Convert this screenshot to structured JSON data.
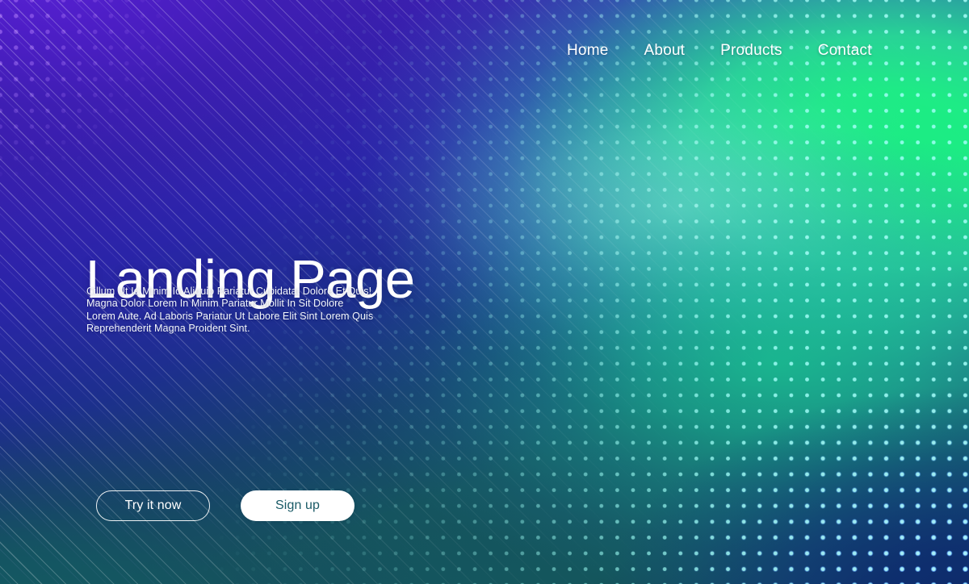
{
  "nav": {
    "items": [
      {
        "label": "Home"
      },
      {
        "label": "About"
      },
      {
        "label": "Products"
      },
      {
        "label": "Contact"
      }
    ]
  },
  "hero": {
    "headline": "Landing Page",
    "paragraphs": [
      "Cillum Ut Id Minim Id Aliquip Pariatur Cupidatat Dolore Et Duis!",
      "Magna Dolor Lorem In Minim Pariatur Mollit In Sit Dolore",
      "Lorem Aute. Ad Laboris Pariatur Ut Labore Elit Sint Lorem Quis",
      "Reprehenderit Magna Proident Sint."
    ],
    "cta_primary": "Try it now",
    "cta_secondary": "Sign up"
  },
  "colors": {
    "purple": "#4a1fb8",
    "violet": "#5a21d6",
    "green": "#17f07e",
    "teal": "#14565d",
    "navy": "#0d2a6b",
    "dot_cyan": "#96fff0",
    "dot_blue": "#5696ff",
    "text_white": "#ffffff",
    "button_solid_bg": "#ffffff",
    "button_solid_text": "#1a5a66"
  }
}
